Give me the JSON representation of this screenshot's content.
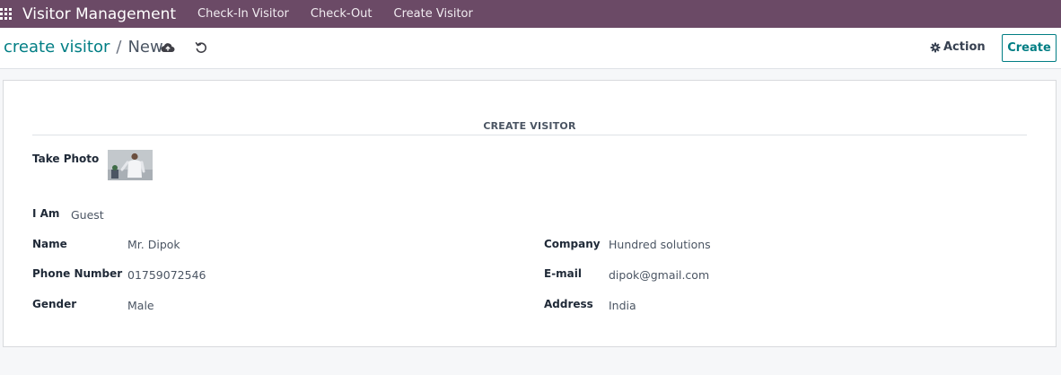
{
  "navbar": {
    "brand": "Visitor Management",
    "menu": [
      "Check-In Visitor",
      "Check-Out",
      "Create Visitor"
    ]
  },
  "controlbar": {
    "breadcrumb_parent": "create visitor",
    "breadcrumb_sep": "/",
    "breadcrumb_current": "New",
    "action_label": "Action",
    "create_label": "Create"
  },
  "form": {
    "title": "CREATE VISITOR",
    "take_photo_label": "Take Photo",
    "i_am_label": "I Am",
    "i_am_value": "Guest",
    "name_label": "Name",
    "name_value": "Mr. Dipok",
    "phone_label": "Phone Number",
    "phone_value": "01759072546",
    "gender_label": "Gender",
    "gender_value": "Male",
    "company_label": "Company",
    "company_value": "Hundred solutions",
    "email_label": "E-mail",
    "email_value": "dipok@gmail.com",
    "address_label": "Address",
    "address_value": "India"
  },
  "colors": {
    "navbar": "#6b4a66",
    "accent": "#017e84"
  }
}
